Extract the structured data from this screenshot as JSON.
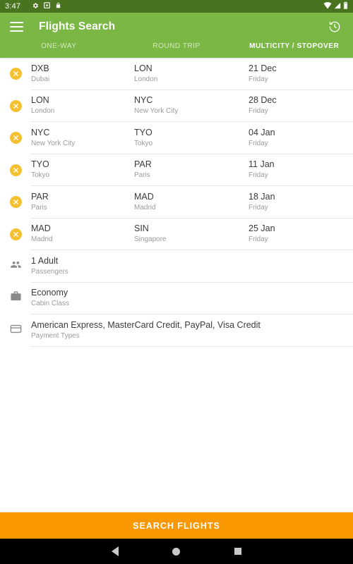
{
  "status_bar": {
    "time": "3:47",
    "left_icons": [
      "settings-gear-icon",
      "screenshot-icon",
      "lock-icon"
    ],
    "right_icons": [
      "wifi-icon",
      "signal-icon",
      "battery-icon"
    ],
    "background": "#4a7320"
  },
  "toolbar": {
    "menu_icon": "hamburger-menu-icon",
    "title": "Flights Search",
    "history_icon": "history-clock-icon",
    "background": "#7ab744"
  },
  "tabs": [
    {
      "label": "ONE-WAY",
      "active": false
    },
    {
      "label": "ROUND TRIP",
      "active": false
    },
    {
      "label": "MULTICITY / STOPOVER",
      "active": true
    }
  ],
  "segments": [
    {
      "remove_icon": "remove-circle-icon",
      "from_code": "DXB",
      "from_city": "Dubai",
      "to_code": "LON",
      "to_city": "London",
      "date": "21 Dec",
      "weekday": "Friday"
    },
    {
      "remove_icon": "remove-circle-icon",
      "from_code": "LON",
      "from_city": "London",
      "to_code": "NYC",
      "to_city": "New York City",
      "date": "28 Dec",
      "weekday": "Friday"
    },
    {
      "remove_icon": "remove-circle-icon",
      "from_code": "NYC",
      "from_city": "New York City",
      "to_code": "TYO",
      "to_city": "Tokyo",
      "date": "04 Jan",
      "weekday": "Friday"
    },
    {
      "remove_icon": "remove-circle-icon",
      "from_code": "TYO",
      "from_city": "Tokyo",
      "to_code": "PAR",
      "to_city": "Paris",
      "date": "11 Jan",
      "weekday": "Friday"
    },
    {
      "remove_icon": "remove-circle-icon",
      "from_code": "PAR",
      "from_city": "Paris",
      "to_code": "MAD",
      "to_city": "Madrid",
      "date": "18 Jan",
      "weekday": "Friday"
    },
    {
      "remove_icon": "remove-circle-icon",
      "from_code": "MAD",
      "from_city": "Madrid",
      "to_code": "SIN",
      "to_city": "Singapore",
      "date": "25 Jan",
      "weekday": "Friday"
    }
  ],
  "options": [
    {
      "icon": "passengers-people-icon",
      "value": "1 Adult",
      "label": "Passengers"
    },
    {
      "icon": "briefcase-icon",
      "value": "Economy",
      "label": "Cabin Class"
    },
    {
      "icon": "credit-card-icon",
      "value": "American Express, MasterCard Credit, PayPal, Visa Credit",
      "label": "Payment Types"
    }
  ],
  "search_button": {
    "label": "SEARCH FLIGHTS",
    "background": "#fb9800"
  },
  "nav_bar": {
    "back_icon": "back-triangle-icon",
    "home_icon": "home-circle-icon",
    "recents_icon": "recents-square-icon"
  },
  "colors": {
    "brand_green": "#7ab744",
    "status_green": "#4a7320",
    "accent_orange": "#fb9800",
    "remove_yellow": "#f5c032"
  }
}
